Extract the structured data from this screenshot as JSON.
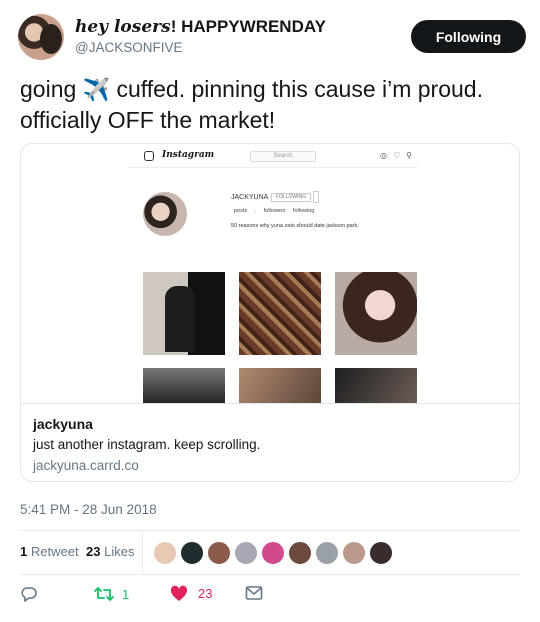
{
  "tweet": {
    "display_name_decor": "hey losers",
    "display_name_rest": "! HAPPYWRENDAY",
    "handle": "@JACKSONFIVE",
    "follow_label": "Following",
    "text_before_emoji": "going ",
    "emoji": "✈️",
    "text_after_emoji": " cuffed. pinning this cause i’m proud. officially OFF the market!",
    "timestamp": "5:41 PM - 28 Jun 2018"
  },
  "card": {
    "title": "jackyuna",
    "description": "just another instagram. keep scrolling.",
    "domain": "jackyuna.carrd.co",
    "preview": {
      "brand": "Instagram",
      "search_placeholder": "Search",
      "username": "JACKYUNA",
      "button": "FOLLOWING",
      "stats": "posts . followers following",
      "bio": "50 reasons why yuna zato should date jackson park."
    }
  },
  "stats": {
    "retweets_count": "1",
    "retweets_label": "Retweet",
    "likes_count": "23",
    "likes_label": "Likes"
  },
  "actions": {
    "retweet_count": "1",
    "like_count": "23"
  },
  "colors": {
    "retweet_green": "#17bf63",
    "like_red": "#e0245e",
    "secondary_text": "#657786",
    "follow_bg": "#14171a"
  }
}
